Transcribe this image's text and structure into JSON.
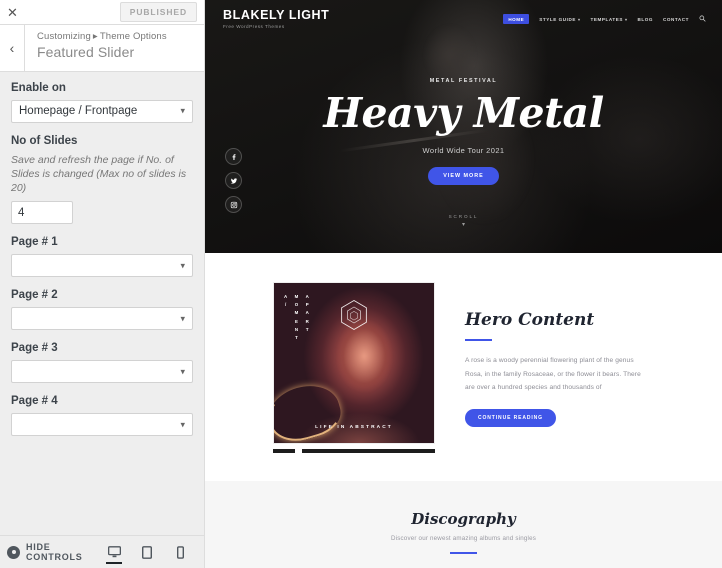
{
  "customizer": {
    "close_icon": "close-icon",
    "publish_label": "Published",
    "back_icon": "chevron-left-icon",
    "breadcrumb_customizing": "Customizing",
    "breadcrumb_separator": "▸",
    "breadcrumb_section": "Theme Options",
    "panel_title": "Featured Slider",
    "controls": {
      "enable_on": {
        "label": "Enable on",
        "value": "Homepage / Frontpage"
      },
      "no_of_slides": {
        "label": "No of Slides",
        "description": "Save and refresh the page if No. of Slides is changed (Max no of slides is 20)",
        "value": "4"
      },
      "pages": [
        {
          "label": "Page # 1",
          "value": ""
        },
        {
          "label": "Page # 2",
          "value": ""
        },
        {
          "label": "Page # 3",
          "value": ""
        },
        {
          "label": "Page # 4",
          "value": ""
        }
      ]
    },
    "footer": {
      "hide_controls_label": "Hide Controls",
      "gear_icon": "gear-icon",
      "devices": [
        {
          "name": "desktop",
          "icon": "desktop-icon",
          "active": true
        },
        {
          "name": "tablet",
          "icon": "tablet-icon",
          "active": false
        },
        {
          "name": "mobile",
          "icon": "mobile-icon",
          "active": false
        }
      ]
    }
  },
  "preview": {
    "site": {
      "brand_name": "BLAKELY LIGHT",
      "brand_tagline": "Free WordPress Themes",
      "nav": [
        {
          "label": "Home",
          "current": true,
          "caret": false
        },
        {
          "label": "Style Guide",
          "current": false,
          "caret": true
        },
        {
          "label": "Templates",
          "current": false,
          "caret": true
        },
        {
          "label": "Blog",
          "current": false,
          "caret": false
        },
        {
          "label": "Contact",
          "current": false,
          "caret": false
        }
      ],
      "search_icon": "search-icon"
    },
    "hero": {
      "eyebrow": "Metal Festival",
      "title": "Heavy Metal",
      "subtitle": "World Wide Tour 2021",
      "button": "View More",
      "socials": [
        {
          "name": "facebook-icon"
        },
        {
          "name": "twitter-icon"
        },
        {
          "name": "instagram-icon"
        }
      ],
      "scroll_label": "Scroll",
      "scroll_icon": "chevron-down-icon"
    },
    "hero_content": {
      "album": {
        "vertical_left": "A/",
        "vertical_mid": "MOMENT",
        "vertical_right": "APART",
        "logo_icon": "hexagon-logo-icon",
        "caption": "Life in Abstract"
      },
      "title": "Hero Content",
      "paragraph": "A rose is a woody perennial flowering plant of the genus Rosa, in the family Rosaceae, or the flower it bears. There are over a hundred species and thousands of",
      "button": "Continue Reading"
    },
    "discography": {
      "title": "Discography",
      "subtitle": "Discover our newest amazing albums and singles"
    }
  },
  "colors": {
    "accent_blue": "#4055e8",
    "nav_current": "#3d4ee0",
    "sidebar_bg": "#eeeeee",
    "heading_dark": "#1f2430"
  }
}
